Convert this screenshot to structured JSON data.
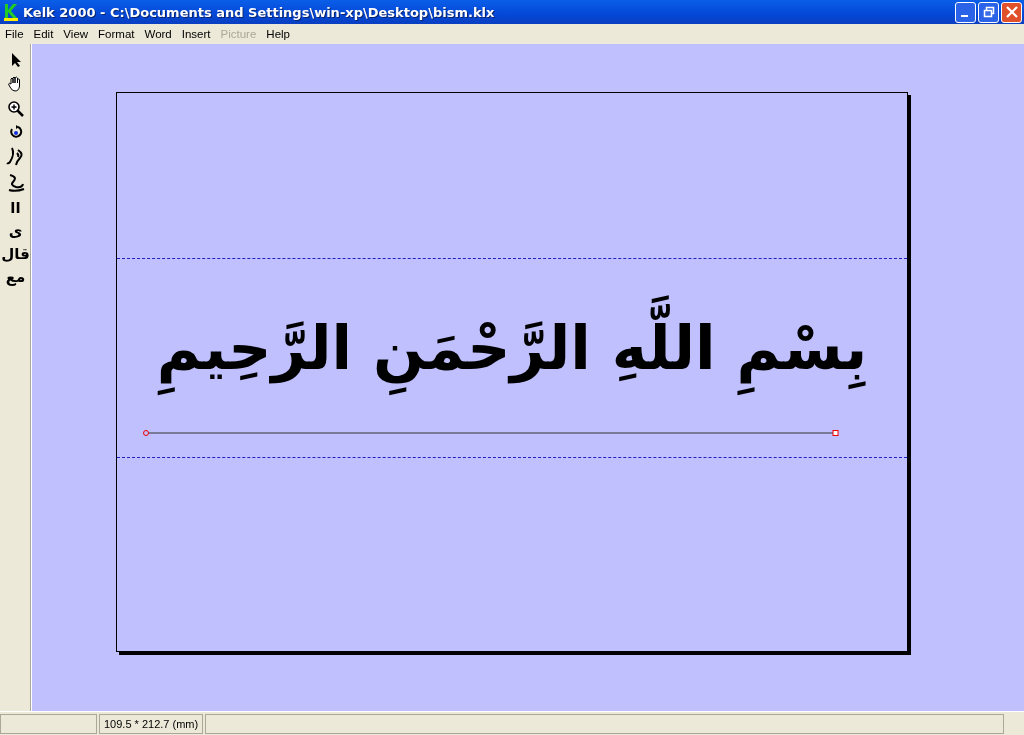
{
  "window": {
    "title": "Kelk 2000 - C:\\Documents and Settings\\win-xp\\Desktop\\bism.klx"
  },
  "menu": [
    {
      "label": "File",
      "disabled": false
    },
    {
      "label": "Edit",
      "disabled": false
    },
    {
      "label": "View",
      "disabled": false
    },
    {
      "label": "Format",
      "disabled": false
    },
    {
      "label": "Word",
      "disabled": false
    },
    {
      "label": "Insert",
      "disabled": false
    },
    {
      "label": "Picture",
      "disabled": true
    },
    {
      "label": "Help",
      "disabled": false
    }
  ],
  "tools": [
    {
      "kind": "pointer"
    },
    {
      "kind": "hand"
    },
    {
      "kind": "zoom"
    },
    {
      "kind": "rotate"
    },
    {
      "kind": "stroke-a"
    },
    {
      "kind": "stroke-b"
    },
    {
      "kind": "glyph",
      "label": "اا"
    },
    {
      "kind": "glyph",
      "label": "ی"
    },
    {
      "kind": "glyph",
      "label": "قال"
    },
    {
      "kind": "glyph",
      "label": "مع"
    }
  ],
  "canvas": {
    "calligraphy": "بِسْمِ اللَّهِ الرَّحْمَنِ الرَّحِيمِ"
  },
  "status_bar": {
    "dimensions": "109.5 * 212.7 (mm)"
  }
}
